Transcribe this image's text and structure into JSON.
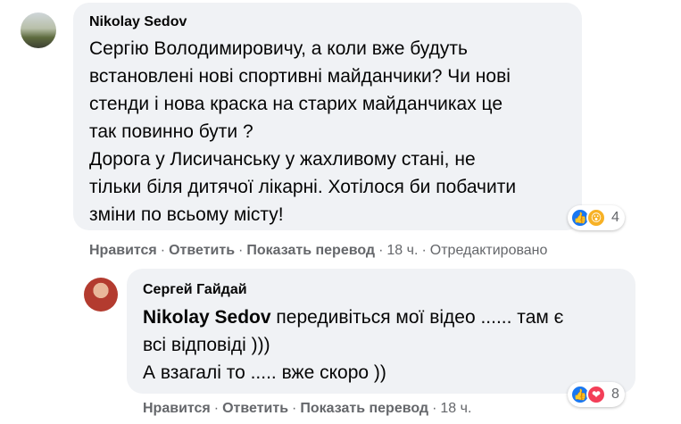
{
  "comments": [
    {
      "author": "Nikolay Sedov",
      "text": "Сергію Володимировичу, а коли вже будуть\nвстановлені нові спортивні майданчики? Чи нові\nстенди і нова краска на старих майданчиках це\nтак повинно бути ?\nДорога у Лисичанську у жахливому стані, не\nтільки біля дитячої лікарні. Хотілося би побачити\nзміни по всьому місту!",
      "reactions": {
        "icons": [
          "like-icon",
          "wow-icon"
        ],
        "count": "4"
      },
      "actions": {
        "like": "Нравится",
        "reply": "Ответить",
        "translate": "Показать перевод",
        "time": "18 ч.",
        "edited": "Отредактировано"
      }
    },
    {
      "author": "Сергей Гайдай",
      "mention": "Nikolay Sedov",
      "text": " передивіться мої відео ...... там є\nвсі відповіді )))\nА взагалі то ..... вже скоро ))",
      "reactions": {
        "icons": [
          "like-icon",
          "love-icon"
        ],
        "count": "8"
      },
      "actions": {
        "like": "Нравится",
        "reply": "Ответить",
        "translate": "Показать перевод",
        "time": "18 ч."
      }
    }
  ],
  "dot": "·",
  "colors": {
    "bubble": "#f0f2f5",
    "meta": "#65676b",
    "like": "#1877f2",
    "wow": "#f7b125",
    "love": "#f33e58"
  }
}
